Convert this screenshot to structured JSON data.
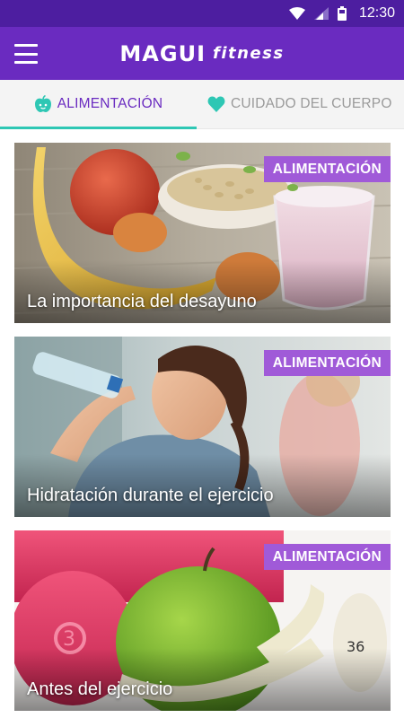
{
  "status_bar": {
    "time": "12:30",
    "icons": [
      "wifi-icon",
      "cell-signal-icon",
      "battery-icon"
    ]
  },
  "app_bar": {
    "brand_main": "MAGUI",
    "brand_sub": "fitness",
    "menu_icon": "hamburger-menu-icon"
  },
  "tabs": [
    {
      "label": "ALIMENTACIÓN",
      "icon": "apple-icon",
      "active": true
    },
    {
      "label": "CUIDADO DEL CUERPO",
      "icon": "heart-icon",
      "active": false
    }
  ],
  "articles": [
    {
      "title": "La importancia del desayuno",
      "badge": "ALIMENTACIÓN"
    },
    {
      "title": "Hidratación durante el ejercicio",
      "badge": "ALIMENTACIÓN"
    },
    {
      "title": "Antes del ejercicio",
      "badge": "ALIMENTACIÓN"
    }
  ],
  "colors": {
    "status_bar": "#4d1ea0",
    "app_bar": "#6a2bc0",
    "tab_active_text": "#6a2bc0",
    "tab_indicator": "#2ec7b4",
    "badge": "#a05ad8"
  }
}
